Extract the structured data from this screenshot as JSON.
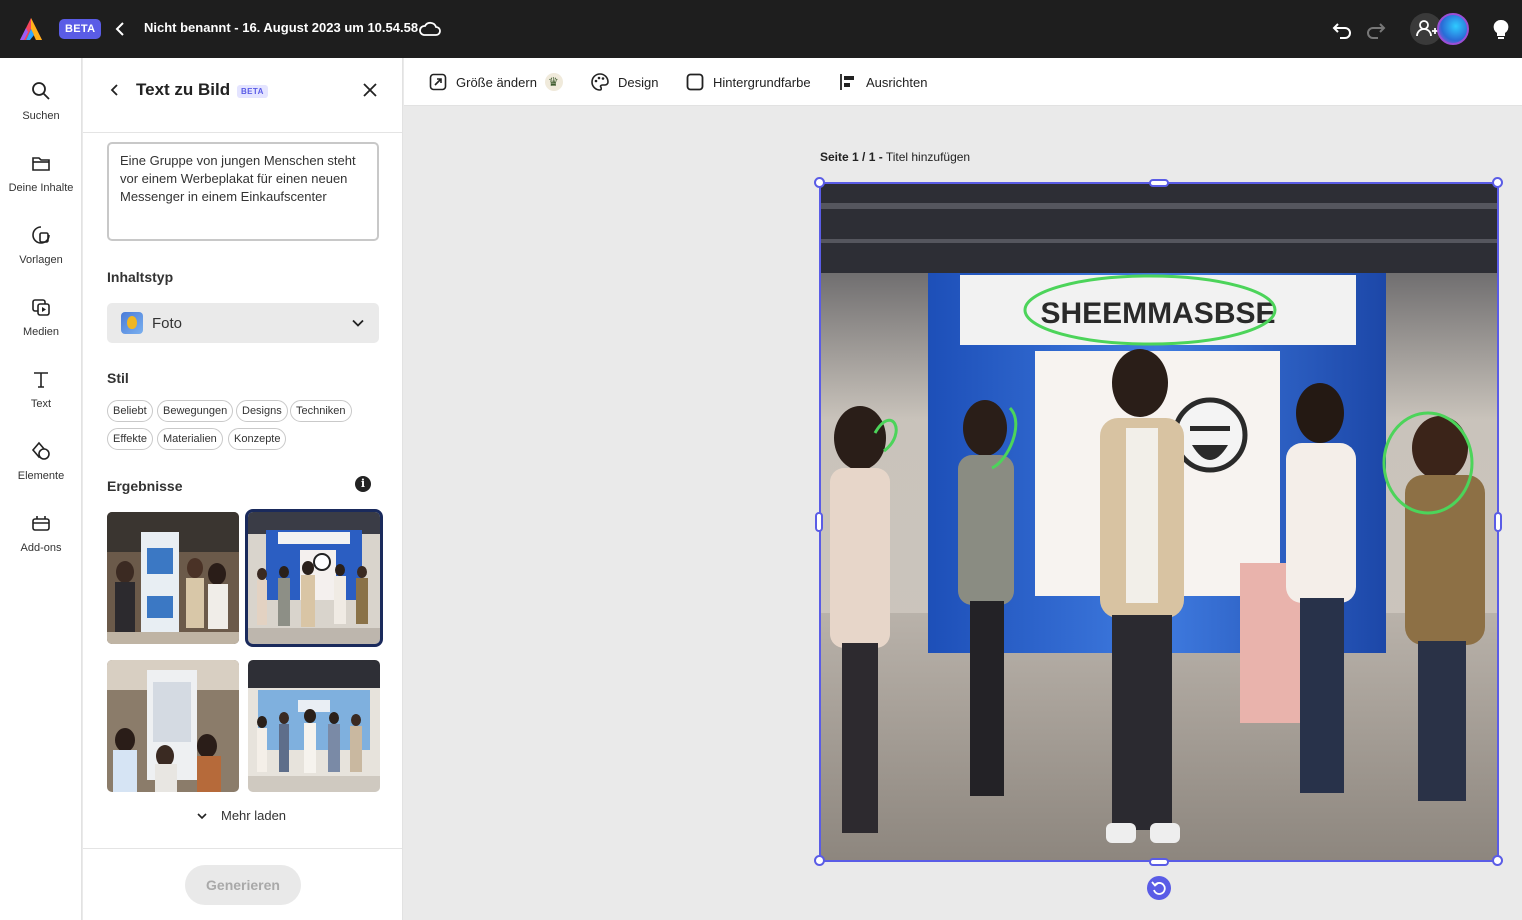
{
  "app": {
    "beta_badge": "BETA",
    "document_title": "Nicht benannt - 16. August 2023 um 10.54.58"
  },
  "rail": {
    "items": [
      {
        "label": "Suchen",
        "icon": "search-icon"
      },
      {
        "label": "Deine Inhalte",
        "icon": "folder-icon"
      },
      {
        "label": "Vorlagen",
        "icon": "templates-icon"
      },
      {
        "label": "Medien",
        "icon": "media-icon"
      },
      {
        "label": "Text",
        "icon": "text-icon"
      },
      {
        "label": "Elemente",
        "icon": "elements-icon"
      },
      {
        "label": "Add-ons",
        "icon": "addons-icon"
      }
    ]
  },
  "panel": {
    "title": "Text zu Bild",
    "beta_badge": "BETA",
    "prompt": "Eine Gruppe von jungen Menschen steht vor einem Werbeplakat für einen neuen Messenger in einem Einkaufscenter",
    "content_type_label": "Inhaltstyp",
    "content_type_value": "Foto",
    "style_label": "Stil",
    "style_chips": [
      "Beliebt",
      "Bewegungen",
      "Designs",
      "Techniken",
      "Effekte",
      "Materialien",
      "Konzepte"
    ],
    "results_label": "Ergebnisse",
    "info_glyph": "i",
    "selected_result_index": 1,
    "more_label": "Mehr laden",
    "generate_label": "Generieren"
  },
  "toolbar": {
    "resize_label": "Größe ändern",
    "design_label": "Design",
    "background_label": "Hintergrundfarbe",
    "align_label": "Ausrichten"
  },
  "canvas": {
    "page_counter": "Seite 1 / 1 -",
    "page_title_placeholder": "Titel hinzufügen",
    "sign_text": "SHEEMMASBSE"
  },
  "colors": {
    "accent": "#5a5ce6",
    "topbar": "#1e1e1e",
    "annotation": "#4cd45a"
  }
}
